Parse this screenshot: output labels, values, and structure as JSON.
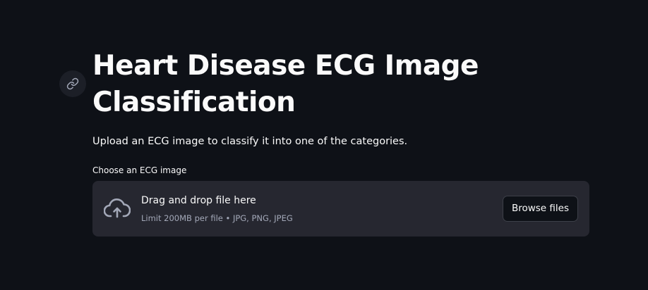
{
  "page": {
    "title": "Heart Disease ECG Image Classification",
    "subtitle": "Upload an ECG image to classify it into one of the categories."
  },
  "anchor_link": {
    "icon": "link-icon"
  },
  "uploader": {
    "label": "Choose an ECG image",
    "drop_title": "Drag and drop file here",
    "drop_hint": "Limit 200MB per file • JPG, PNG, JPEG",
    "icon": "cloud-upload-icon",
    "browse_label": "Browse files"
  },
  "colors": {
    "background": "#0e1117",
    "dropzone": "#262730",
    "text": "#fafafa",
    "muted_text": "#a3a8b8"
  }
}
